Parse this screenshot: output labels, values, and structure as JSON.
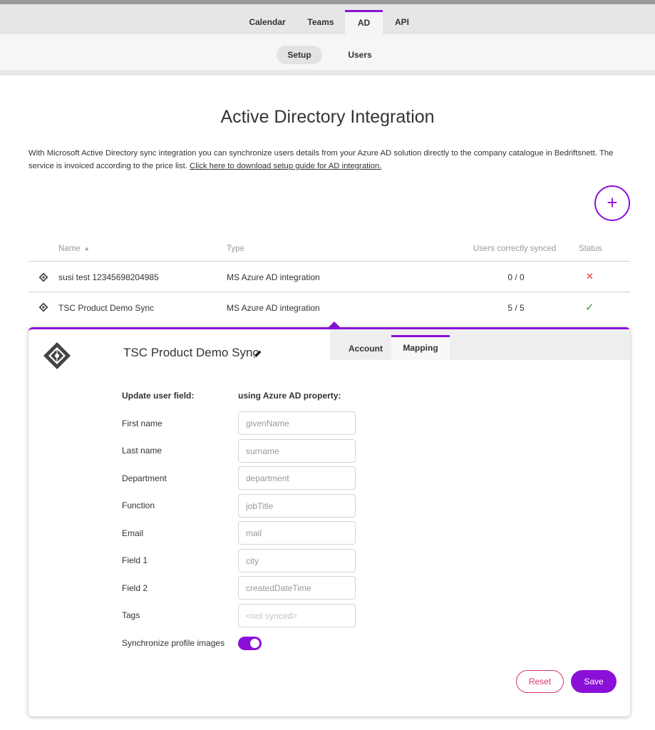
{
  "colors": {
    "accent": "#8a10d8",
    "danger": "#d9346f",
    "error_mark": "#e53935",
    "success_mark": "#2e9e4a"
  },
  "nav": {
    "tabs": [
      {
        "label": "Calendar"
      },
      {
        "label": "Teams"
      },
      {
        "label": "AD",
        "active": true
      },
      {
        "label": "API"
      }
    ],
    "subtabs": [
      {
        "label": "Setup",
        "active": true
      },
      {
        "label": "Users"
      }
    ]
  },
  "page": {
    "title": "Active Directory Integration",
    "intro": "With Microsoft Active Directory sync integration you can synchronize users details from your Azure AD solution directly to the company catalogue in Bedriftsnett. The service is invoiced according to the price list.",
    "guide_link": "Click here to download setup guide for AD integration.",
    "add_icon": "plus-icon"
  },
  "table": {
    "headers": {
      "name": "Name",
      "sort_indicator": "▲",
      "type": "Type",
      "synced": "Users correctly synced",
      "status": "Status"
    },
    "rows": [
      {
        "name": "susi test 12345698204985",
        "type": "MS Azure AD integration",
        "synced": "0 / 0",
        "status_icon": "cross-icon",
        "status_glyph": "✕"
      },
      {
        "name": "TSC Product Demo Sync",
        "type": "MS Azure AD integration",
        "synced": "5 / 5",
        "status_icon": "checkmark-icon",
        "status_glyph": "✓"
      }
    ]
  },
  "panel": {
    "title": "TSC Product Demo Sync",
    "tabs": [
      {
        "label": "Account"
      },
      {
        "label": "Mapping",
        "active": true
      }
    ],
    "col_update": "Update user field:",
    "col_property": "using Azure AD property:",
    "fields": [
      {
        "label": "First name",
        "placeholder": "givenName"
      },
      {
        "label": "Last name",
        "placeholder": "surname"
      },
      {
        "label": "Department",
        "placeholder": "department"
      },
      {
        "label": "Function",
        "placeholder": "jobTitle"
      },
      {
        "label": "Email",
        "placeholder": "mail"
      },
      {
        "label": "Field 1",
        "placeholder": "city"
      },
      {
        "label": "Field 2",
        "placeholder": "createdDateTime"
      },
      {
        "label": "Tags",
        "placeholder": "<not synced>"
      }
    ],
    "sync_images_label": "Synchronize profile images",
    "sync_images_on": true,
    "reset_label": "Reset",
    "save_label": "Save"
  }
}
